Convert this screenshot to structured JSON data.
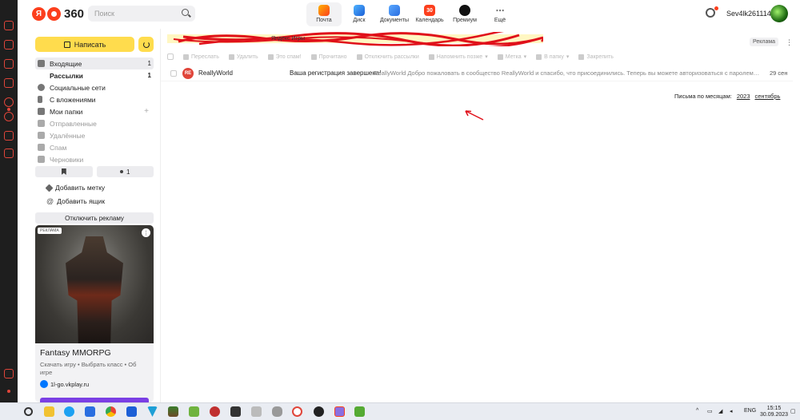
{
  "header": {
    "logo_ya": "Я",
    "logo_text": "360",
    "search_placeholder": "Поиск",
    "services": [
      {
        "label": "Почта",
        "icon": "mail-icon",
        "active": true,
        "badge": ""
      },
      {
        "label": "Диск",
        "icon": "disk-icon",
        "active": false,
        "badge": ""
      },
      {
        "label": "Документы",
        "icon": "documents-icon",
        "active": false,
        "badge": ""
      },
      {
        "label": "Календарь",
        "icon": "calendar-icon",
        "active": false,
        "badge": "30"
      },
      {
        "label": "Премиум",
        "icon": "premium-icon",
        "active": false,
        "badge": ""
      },
      {
        "label": "Ещё",
        "icon": "more-icon",
        "active": false,
        "badge": "⋯"
      }
    ],
    "username": "Sev4lk261114"
  },
  "sidebar": {
    "compose_label": "Написать",
    "folders": [
      {
        "label": "Входящие",
        "count": "1",
        "active": true,
        "bold": false,
        "muted": false
      },
      {
        "label": "Рассылки",
        "count": "1",
        "active": false,
        "bold": true,
        "muted": false
      },
      {
        "label": "Социальные сети",
        "count": "",
        "active": false,
        "bold": false,
        "muted": false
      },
      {
        "label": "С вложениями",
        "count": "",
        "active": false,
        "bold": false,
        "muted": false
      },
      {
        "label": "Мои папки",
        "count": "+",
        "active": false,
        "bold": false,
        "muted": false
      },
      {
        "label": "Отправленные",
        "count": "",
        "active": false,
        "bold": false,
        "muted": true
      },
      {
        "label": "Удалённые",
        "count": "",
        "active": false,
        "bold": false,
        "muted": true
      },
      {
        "label": "Спам",
        "count": "",
        "active": false,
        "bold": false,
        "muted": true
      },
      {
        "label": "Черновики",
        "count": "",
        "active": false,
        "bold": false,
        "muted": true
      }
    ],
    "chip_count": "1",
    "add_label": "Добавить метку",
    "add_box": "Добавить ящик",
    "disable_ads": "Отключить рекламу",
    "ad": {
      "badge": "РЕКЛАМА",
      "title": "Fantasy MMORPG",
      "subtitle": "Скачать игру • Выбрать класс • Об игре",
      "domain": "1l-go.vkplay.ru"
    }
  },
  "main": {
    "banner_text": "Яндекс Игры",
    "ad_tag": "Реклама",
    "toolbar": [
      "Переслать",
      "Удалить",
      "Это спам!",
      "Прочитано",
      "Отключить рассылки",
      "Напомнить позже",
      "Метка",
      "В папку",
      "Закрепить"
    ],
    "mail": {
      "avatar": "RE",
      "sender": "ReallyWorld",
      "subject": "Ваша регистрация завершена!",
      "preview": "ReallyWorld Добро пожаловать в сообщество ReallyWorld и спасибо, что присоединились. Теперь вы можете авторизоваться с паролем, который ука…",
      "date": "29 сен"
    },
    "months_label": "Письма по месяцам:",
    "year": "2023",
    "month": "сентябрь"
  },
  "taskbar": {
    "lang": "ENG",
    "time": "15:15",
    "date": "30.09.2023"
  },
  "colors": {
    "accent_yellow": "#ffdc4d",
    "brand_red": "#fc3f1d",
    "annotation_red": "#e0101a"
  }
}
